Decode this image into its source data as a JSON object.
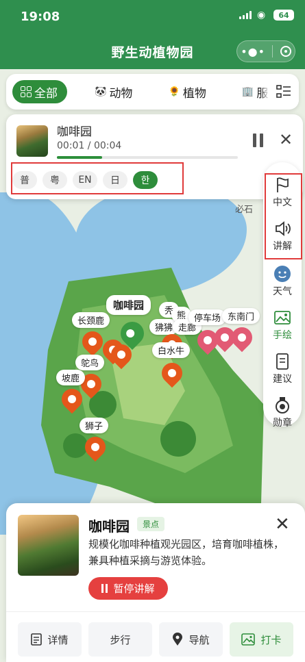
{
  "status": {
    "time": "19:08",
    "battery": "64"
  },
  "app": {
    "title": "野生动植物园"
  },
  "tabs": [
    {
      "label": "全部",
      "icon": "grid-icon"
    },
    {
      "label": "动物",
      "icon": "panda-icon"
    },
    {
      "label": "植物",
      "icon": "plant-icon"
    },
    {
      "label": "服",
      "icon": "service-icon"
    }
  ],
  "player": {
    "title": "咖啡园",
    "time": "00:01 / 00:04",
    "progress": 0.25,
    "languages": [
      "普",
      "粤",
      "EN",
      "日",
      "한"
    ],
    "active_language": "한"
  },
  "toolbar": [
    {
      "label": "中文",
      "icon": "flag-icon"
    },
    {
      "label": "讲解",
      "icon": "speaker-icon"
    },
    {
      "label": "天气",
      "icon": "weather-icon"
    },
    {
      "label": "手绘",
      "icon": "image-icon"
    },
    {
      "label": "建议",
      "icon": "note-icon"
    },
    {
      "label": "勋章",
      "icon": "medal-icon"
    }
  ],
  "map": {
    "labels": {
      "bishi": "必石",
      "coffee": "咖啡园",
      "giraffe": "长颈鹿",
      "ostrich": "鸵鸟",
      "deer": "坡鹿",
      "lion": "狮子",
      "baboon": "狒狒",
      "bear": "熊",
      "corridor": "走廊",
      "parking": "停车场",
      "east_gate": "东南门",
      "buffalo": "白水牛",
      "bald": "秃"
    }
  },
  "card": {
    "title": "咖啡园",
    "badge": "景点",
    "description": "规模化咖啡种植观光园区，培育咖啡植株，兼具种植采摘与游览体验。",
    "pause_label": "暂停讲解",
    "actions": [
      {
        "label": "详情",
        "icon": "document-icon"
      },
      {
        "label": "步行",
        "icon": ""
      },
      {
        "label": "导航",
        "icon": "location-icon"
      },
      {
        "label": "打卡",
        "icon": "photo-icon"
      }
    ]
  },
  "colors": {
    "header": "#2f8f4e",
    "accent": "#2e8d3b",
    "danger": "#e5403f",
    "highlight": "#e03a3a"
  }
}
